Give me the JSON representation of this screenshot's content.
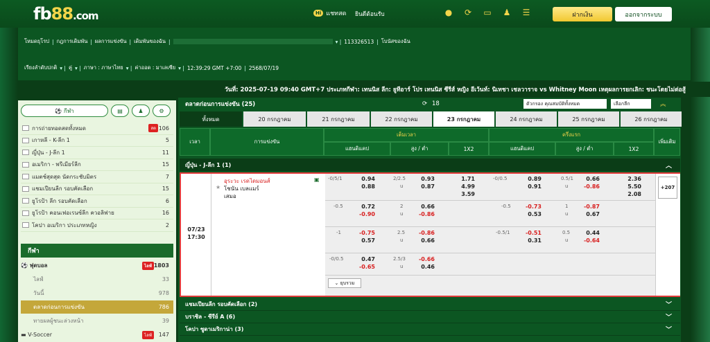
{
  "header": {
    "logo_main": "fb",
    "logo_num": "88",
    "logo_tld": ".com",
    "chat_badge": "Hi",
    "chat": "แชทสด",
    "welcome": "ยินดีต้อนรับ",
    "deposit": "ฝากเงิน",
    "logout": "ออกจากระบบ",
    "icons": [
      "coins-icon",
      "refresh-icon",
      "cards-icon",
      "user-icon",
      "list-icon"
    ]
  },
  "nav": {
    "row1": [
      "โหมดยุโรป",
      "กฎการเดิมพัน",
      "ผลการแข่งขัน",
      "เดิมพันของฉัน",
      "113326513",
      "โบนัสของฉัน"
    ],
    "row2": [
      "เรียงลำดับปกติ",
      "คู่",
      "ภาษา : ภาษาไทย",
      "ค่าออด : มาเลเซีย",
      "12:39:29 GMT +7:00",
      "2568/07/19"
    ]
  },
  "marquee": "วันที่: 2025-07-19 09:40 GMT+7 ประเภทกีฬา: เทนนิส ลีก: ยูทีอาร์ โปร เทนนิส ซีรีส์ หญิง อีเว้นท์: นิเทชา เชลวาราจ vs Whitney Moon เหตุผลการยกเลิก: ชนะโดยไม่ต่อสู้",
  "sidebar": {
    "tool_sport": "กีฬา",
    "leagues": [
      {
        "name": "การถ่ายทอดสดทั้งหมด",
        "count": "106",
        "live": "สด"
      },
      {
        "name": "เกาหลี - K-ลีก 1",
        "count": "5"
      },
      {
        "name": "ญี่ปุ่น - J-ลีก 1",
        "count": "11"
      },
      {
        "name": "อเมริกา - พรีเมียร์ลีก",
        "count": "15"
      },
      {
        "name": "แมตช์สุดสุด นัดกระชับมิตร",
        "count": "7"
      },
      {
        "name": "แชมเปียนลีก รอบคัดเลือก",
        "count": "15"
      },
      {
        "name": "ยูโรป้า ลีก รอบคัดเลือก",
        "count": "6"
      },
      {
        "name": "ยูโรป้า คอนเฟอเรนซ์ลีก ควอลิฟาย",
        "count": "16"
      },
      {
        "name": "โคปา อเมริกา ประเภทหญิง",
        "count": "2"
      }
    ],
    "sport_title": "กีฬา",
    "football": "ฟุตบอล",
    "football_live": "ไลฟ์",
    "football_count": "1803",
    "subs": [
      {
        "name": "ไลฟ์",
        "count": "33"
      },
      {
        "name": "วันนี้",
        "count": "978"
      },
      {
        "name": "ตลาดก่อนการแข่งขัน",
        "count": "786"
      },
      {
        "name": "ทายผลผู้ชนะล่วงหน้า",
        "count": "39"
      }
    ],
    "vsoccer": "V-Soccer",
    "vsoccer_live": "ไลฟ์",
    "vsoccer_count": "147"
  },
  "main": {
    "title": "ตลาดก่อนการแข่งขัน (25)",
    "refresh_count": "18",
    "sort": "ตัวกรอง คุณสมบัติทั้งหมด",
    "filter": "เลือกลีก",
    "tabs": [
      "ทั้งหมด",
      "20 กรกฎาคม",
      "21 กรกฎาคม",
      "22 กรกฎาคม",
      "23 กรกฎาคม",
      "24 กรกฎาคม",
      "25 กรกฎาคม",
      "26 กรกฎาคม"
    ],
    "th_time": "เวลา",
    "th_match": "การแข่งขัน",
    "th_full": "เต็มเวลา",
    "th_half": "ครึ่งแรก",
    "th_more": "เพิ่มเติม",
    "th_hdp": "แฮนดิแคป",
    "th_ou": "สูง / ต่ำ",
    "th_1x2": "1X2",
    "league": "ญี่ปุ่น - J-ลีก 1 (1)",
    "date": "07/23",
    "time": "17:30",
    "home": "อุระวะ เรดไดมอนส์",
    "away": "โชนัน เบลแมร์",
    "draw": "เสมอ",
    "more": "+207",
    "collapse": "ยุบรวม",
    "groups": [
      "แชมเปียนลีก รอบคัดเลือก (2)",
      "บราซิล - ซีรีย์ A (6)",
      "โคปา ซูดาเมริกาน่า (3)"
    ]
  },
  "odds": [
    {
      "fh": "-0/5/1",
      "fh1": "0.94",
      "fh2": "0.88",
      "fo": "2/2.5",
      "fou": "u",
      "fo1": "0.93",
      "fo2": "0.87",
      "x1": "1.71",
      "x2": "4.99",
      "x3": "3.59",
      "hh": "-0/0.5",
      "hh1": "0.89",
      "hh2": "0.91",
      "ho": "0.5/1",
      "hou": "u",
      "ho1": "0.66",
      "ho2": "-0.86",
      "y1": "2.36",
      "y2": "5.50",
      "y3": "2.08"
    },
    {
      "fh": "-0.5",
      "fh1": "0.72",
      "fh2": "-0.90",
      "fo": "2",
      "fou": "u",
      "fo1": "0.66",
      "fo2": "-0.86",
      "hh": "-0.5",
      "hh1": "-0.73",
      "hh2": "0.53",
      "ho": "1",
      "hou": "u",
      "ho1": "-0.87",
      "ho2": "0.67"
    },
    {
      "fh": "-1",
      "fh1": "-0.75",
      "fh2": "0.57",
      "fo": "2.5",
      "fou": "u",
      "fo1": "-0.86",
      "fo2": "0.66",
      "hh": "-0.5/1",
      "hh1": "-0.51",
      "hh2": "0.31",
      "ho": "0.5",
      "hou": "u",
      "ho1": "0.44",
      "ho2": "-0.64"
    },
    {
      "fh": "-0/0.5",
      "fh1": "0.47",
      "fh2": "-0.65",
      "fo": "2.5/3",
      "fou": "u",
      "fo1": "-0.66",
      "fo2": "0.46"
    }
  ]
}
